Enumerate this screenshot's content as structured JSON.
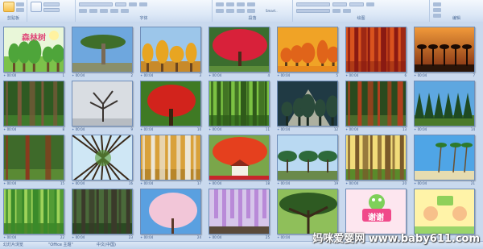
{
  "ribbon": {
    "groups": [
      {
        "label": "剪贴板"
      },
      {
        "label": "字体"
      },
      {
        "label": "段落"
      },
      {
        "label": "绘图"
      },
      {
        "label": "编辑"
      }
    ],
    "font_tool": "Smart.."
  },
  "slides": [
    {
      "number": "1",
      "meta": "00:00",
      "text": "森林树",
      "theme": "title"
    },
    {
      "number": "2",
      "meta": "00:04",
      "theme": "dragon"
    },
    {
      "number": "3",
      "meta": "00:04",
      "theme": "autumn"
    },
    {
      "number": "4",
      "meta": "00:04",
      "theme": "red"
    },
    {
      "number": "5",
      "meta": "00:04",
      "theme": "orange"
    },
    {
      "number": "6",
      "meta": "00:04",
      "theme": "redtrunks"
    },
    {
      "number": "7",
      "meta": "00:04",
      "theme": "sunset"
    },
    {
      "number": "8",
      "meta": "00:04",
      "theme": "eucalyptus"
    },
    {
      "number": "9",
      "meta": "00:04",
      "theme": "bare"
    },
    {
      "number": "10",
      "meta": "00:04",
      "theme": "maple"
    },
    {
      "number": "11",
      "meta": "00:04",
      "theme": "greenforest"
    },
    {
      "number": "12",
      "meta": "00:04",
      "theme": "sunbeam"
    },
    {
      "number": "13",
      "meta": "00:04",
      "theme": "redwood"
    },
    {
      "number": "14",
      "meta": "00:04",
      "theme": "pines"
    },
    {
      "number": "15",
      "meta": "00:04",
      "theme": "sequoia"
    },
    {
      "number": "16",
      "meta": "00:04",
      "theme": "lookup"
    },
    {
      "number": "17",
      "meta": "00:04",
      "theme": "birch"
    },
    {
      "number": "18",
      "meta": "00:04",
      "theme": "redhouse"
    },
    {
      "number": "19",
      "meta": "00:04",
      "theme": "umbrella"
    },
    {
      "number": "20",
      "meta": "00:04",
      "theme": "sunforest"
    },
    {
      "number": "21",
      "meta": "00:04",
      "theme": "palms"
    },
    {
      "number": "22",
      "meta": "00:04",
      "theme": "bamboo"
    },
    {
      "number": "23",
      "meta": "00:04",
      "theme": "tallforest"
    },
    {
      "number": "24",
      "meta": "00:04",
      "theme": "blossom"
    },
    {
      "number": "25",
      "meta": "00:04",
      "theme": "wisteria"
    },
    {
      "number": "26",
      "meta": "00:04",
      "theme": "oak"
    },
    {
      "number": "27",
      "meta": "00:04",
      "text": "谢谢",
      "theme": "thanks"
    },
    {
      "number": "28",
      "meta": "00:04",
      "theme": "kids"
    }
  ],
  "statusbar": {
    "left": "幻灯片浏览",
    "theme": "\"Office 主题\"",
    "lang": "中文(中国)"
  },
  "watermark": "妈咪爱婴网 www.baby611.com"
}
